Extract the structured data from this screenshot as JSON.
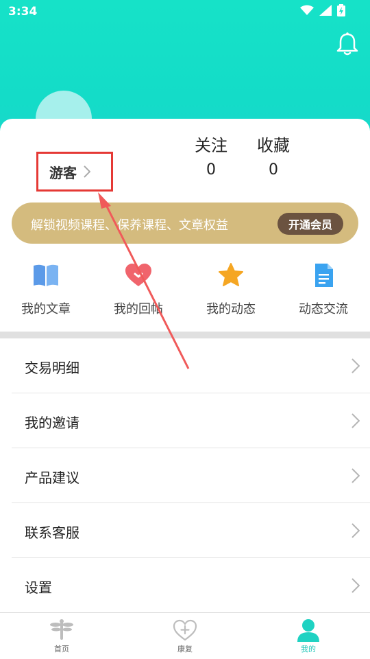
{
  "status_bar": {
    "time": "3:34"
  },
  "header": {
    "bell_icon": "bell-icon"
  },
  "profile": {
    "username": "游客",
    "stats": [
      {
        "label": "关注",
        "value": "0"
      },
      {
        "label": "收藏",
        "value": "0"
      }
    ]
  },
  "vip": {
    "text": "解锁视频课程、保养课程、文章权益",
    "button": "开通会员"
  },
  "quick_actions": [
    {
      "label": "我的文章",
      "icon": "book-icon"
    },
    {
      "label": "我的回帖",
      "icon": "heart-icon"
    },
    {
      "label": "我的动态",
      "icon": "star-icon"
    },
    {
      "label": "动态交流",
      "icon": "document-icon"
    }
  ],
  "menu": [
    {
      "label": "交易明细"
    },
    {
      "label": "我的邀请"
    },
    {
      "label": "产品建议"
    },
    {
      "label": "联系客服"
    },
    {
      "label": "设置"
    }
  ],
  "tabs": [
    {
      "label": "首页",
      "icon": "dragonfly-icon"
    },
    {
      "label": "康复",
      "icon": "heart-plus-icon"
    },
    {
      "label": "我的",
      "icon": "person-icon"
    }
  ],
  "colors": {
    "accent": "#16e2c8",
    "vip_banner": "#d4bb7e",
    "vip_button": "#6b5340",
    "highlight_red": "#e53935"
  }
}
